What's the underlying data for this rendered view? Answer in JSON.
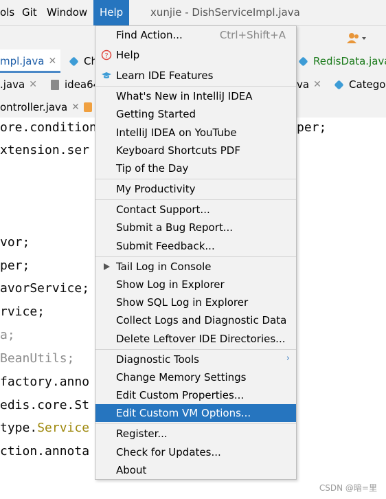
{
  "menubar": {
    "items": [
      "ols",
      "Git",
      "Window",
      "Help"
    ],
    "window_title": "xunjie - DishServiceImpl.java"
  },
  "tabs_row1": {
    "tabs": [
      "mpl.java",
      "Ch",
      "RedisData.java"
    ]
  },
  "tabs_row2": {
    "tabs": [
      ".java",
      "idea64",
      "va",
      "Catego"
    ]
  },
  "tabs_row3": {
    "tabs": [
      "ontroller.java"
    ]
  },
  "editor": {
    "lines": [
      "ore.condition",
      "xtension.ser",
      "",
      "",
      "",
      "vor;",
      "per;",
      "avorService;",
      "rvice;",
      "a;",
      "BeanUtils;",
      "factory.anno",
      "edis.core.St",
      "type.",
      "ction.annota"
    ],
    "right_fragment": "per;",
    "service_keyword": "Service"
  },
  "help_menu": {
    "groups": [
      [
        {
          "label": "Find Action...",
          "shortcut": "Ctrl+Shift+A"
        },
        {
          "label": "Help",
          "icon": "question-circle-icon"
        },
        {
          "label": "Learn IDE Features",
          "icon": "graduation-cap-icon"
        }
      ],
      [
        {
          "label": "What's New in IntelliJ IDEA"
        },
        {
          "label": "Getting Started"
        },
        {
          "label": "IntelliJ IDEA on YouTube"
        },
        {
          "label": "Keyboard Shortcuts PDF"
        },
        {
          "label": "Tip of the Day"
        }
      ],
      [
        {
          "label": "My Productivity"
        }
      ],
      [
        {
          "label": "Contact Support..."
        },
        {
          "label": "Submit a Bug Report..."
        },
        {
          "label": "Submit Feedback..."
        }
      ],
      [
        {
          "label": "Tail Log in Console",
          "icon": "play-icon"
        },
        {
          "label": "Show Log in Explorer"
        },
        {
          "label": "Show SQL Log in Explorer"
        },
        {
          "label": "Collect Logs and Diagnostic Data"
        },
        {
          "label": "Delete Leftover IDE Directories..."
        }
      ],
      [
        {
          "label": "Diagnostic Tools",
          "submenu": true
        },
        {
          "label": "Change Memory Settings"
        },
        {
          "label": "Edit Custom Properties..."
        },
        {
          "label": "Edit Custom VM Options...",
          "highlighted": true
        }
      ],
      [
        {
          "label": "Register..."
        },
        {
          "label": "Check for Updates..."
        },
        {
          "label": "About"
        }
      ]
    ]
  },
  "watermark": "CSDN @暗=里",
  "colors": {
    "accent": "#2675bf",
    "menu_bg": "#f2f2f2",
    "keyword": "#9e880d"
  }
}
